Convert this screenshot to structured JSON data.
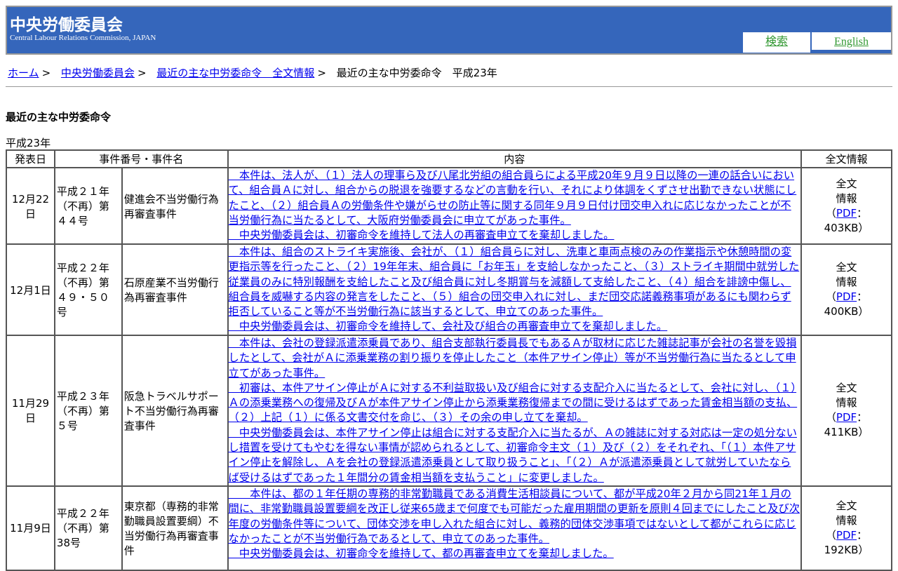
{
  "header": {
    "title": "中央労働委員会",
    "subtitle": "Central Labour Relations Commission, JAPAN",
    "search": "検索",
    "english": "English"
  },
  "breadcrumb": {
    "items": [
      "ホーム",
      "中央労働委員会",
      "最近の主な中労委命令　全文情報"
    ],
    "current": "最近の主な中労委命令　平成23年",
    "sep": ">"
  },
  "page_title": "最近の主な中労委命令",
  "year": "平成23年",
  "table": {
    "headers": [
      "発表日",
      "事件番号・事件名",
      "内容",
      "全文情報"
    ],
    "full_label_1": "全文",
    "full_label_2": "情報",
    "pdf": "PDF",
    "rows": [
      {
        "date": "12月22日",
        "number": "平成２１年（不再）第４４号",
        "name": "健進会不当労働行為再審査事件",
        "size": "403KB",
        "paras": [
          "　本件は、法人が、（１）法人の理事ら及び八尾北労組の組合員らによる平成20年９月９日以降の一連の話合いにおいて、組合員Ａに対し、組合からの脱退を強要するなどの言動を行い、それにより体調をくずさせ出勤できない状態にしたこと、（２）組合員Ａの労働条件や嫌がらせの防止等に関する同年９月９日付け団交申入れに応じなかったことが不当労働行為に当たるとして、大阪府労働委員会に申立てがあった事件。",
          "　中央労働委員会は、初審命令を維持して法人の再審査申立てを棄却しました。"
        ]
      },
      {
        "date": "12月1日",
        "number": "平成２２年（不再）第４９・５０号",
        "name": "石原産業不当労働行為再審査事件",
        "size": "400KB",
        "paras": [
          "　本件は、組合のストライキ実施後、会社が、（１）組合員らに対し、洗車と車両点検のみの作業指示や休憩時間の変更指示等を行ったこと、（２）19年年末、組合員に「お年玉」を支給しなかったこと、（３）ストライキ期間中就労した従業員のみに特別報酬を支給したこと及び組合員に対し冬期賞与を減額して支給したこと、（４）組合を誹謗中傷し、組合員を威嚇する内容の発言をしたこと、（５）組合の団交申入れに対し、まだ団交応諾義務事項があるにも関わらず拒否していること等が不当労働行為に該当するとして、申立てのあった事件。",
          "　中央労働委員会は、初審命令を維持して、会社及び組合の再審査申立てを棄却しました。"
        ]
      },
      {
        "date": "11月29日",
        "number": "平成２３年（不再）第５号",
        "name": "阪急トラベルサポート不当労働行為再審査事件",
        "size": "411KB",
        "paras": [
          "　本件は、会社の登録派遣添乗員であり、組合支部執行委員長でもあるＡが取材に応じた雑誌記事が会社の名誉を毀損したとして、会社がＡに添乗業務の割り振りを停止したこと（本件アサイン停止）等が不当労働行為に当たるとして申立てがあった事件。",
          "　初審は、本件アサイン停止がＡに対する不利益取扱い及び組合に対する支配介入に当たるとして、会社に対し、（１）Ａの添乗業務への復帰及びＡが本件アサイン停止から添乗業務復帰までの間に受けるはずであった賃金相当額の支払、（２）上記（１）に係る文書交付を命じ、（３）その余の申し立てを棄却。",
          "　中央労働委員会は、本件アサイン停止は組合に対する支配介入に当たるが、Ａの雑誌に対する対応は一定の処分ないし措置を受けてもやむを得ない事情が認められるとして、初審命令主文（１）及び（２）をそれぞれ、「（１）本件アサイン停止を解除し、Ａを会社の登録派遣添乗員として取り扱うこと」、「（２）Ａが派遣添乗員として就労していたならば受けるはずであった１年間分の賃金相当額を支払うこと」に変更しました。"
        ]
      },
      {
        "date": "11月9日",
        "number": "平成２２年（不再）第38号",
        "name": "東京都（専務的非常勤職員設置要綱）不当労働行為再審査事件",
        "size": "192KB",
        "paras": [
          "　　本件は、都の１年任期の専務的非常勤職員である消費生活相談員について、都が平成20年２月から同21年１月の間に、非常勤職員設置要綱を改正し従来65歳まで何度でも可能だった雇用期間の更新を原則４回までにしたこと及び次年度の労働条件等について、団体交渉を申し入れた組合に対し、義務的団体交渉事項ではないとして都がこれらに応じなかったことが不当労働行為であるとして、申立てのあった事件。",
          "　中央労働委員会は、初審命令を維持して、都の再審査申立てを棄却しました。"
        ]
      }
    ]
  }
}
